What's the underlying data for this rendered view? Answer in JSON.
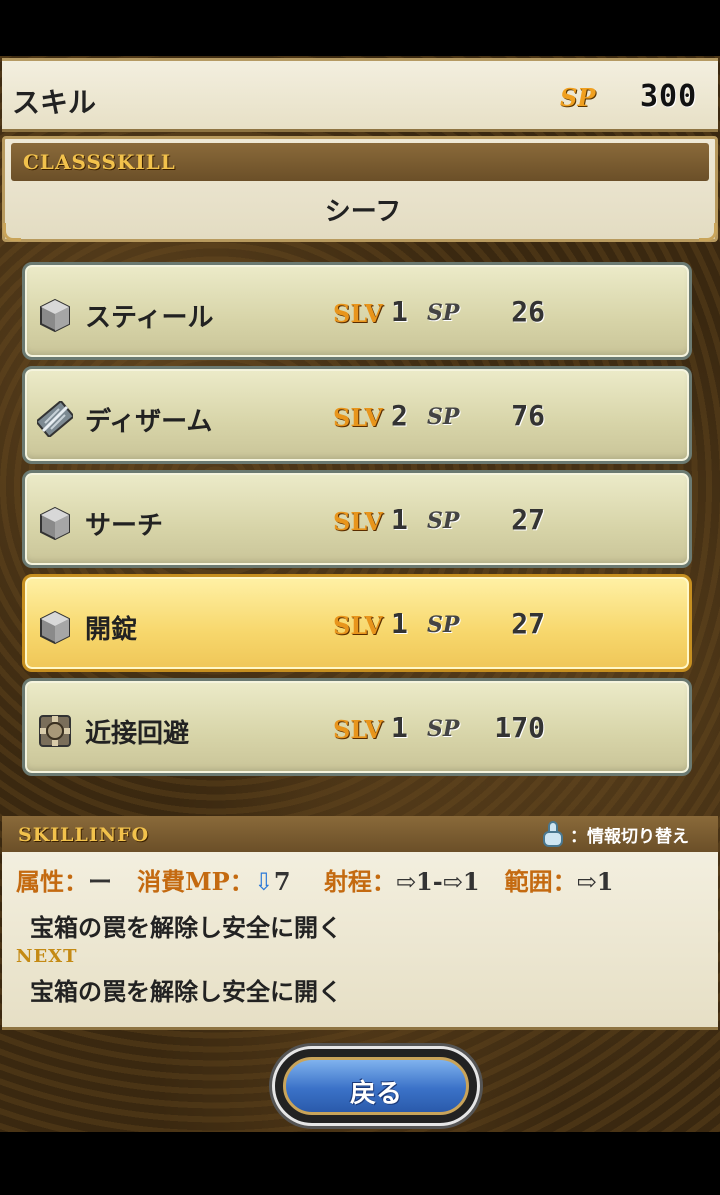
{
  "header": {
    "title": "スキル",
    "sp_label": "SP",
    "sp_value": "300"
  },
  "class_skill": {
    "label": "CLASSSKILL",
    "class_name": "シーフ"
  },
  "skills": [
    {
      "name": "スティール",
      "slv_label": "SLV",
      "slv": "1",
      "sp_label": "SP",
      "sp": "26",
      "icon": "cube-icon",
      "selected": false
    },
    {
      "name": "ディザーム",
      "slv_label": "SLV",
      "slv": "2",
      "sp_label": "SP",
      "sp": "76",
      "icon": "crossed-swords-icon",
      "selected": false
    },
    {
      "name": "サーチ",
      "slv_label": "SLV",
      "slv": "1",
      "sp_label": "SP",
      "sp": "27",
      "icon": "cube-icon",
      "selected": false
    },
    {
      "name": "開錠",
      "slv_label": "SLV",
      "slv": "1",
      "sp_label": "SP",
      "sp": "27",
      "icon": "cube-icon",
      "selected": true
    },
    {
      "name": "近接回避",
      "slv_label": "SLV",
      "slv": "1",
      "sp_label": "SP",
      "sp": "170",
      "icon": "dodge-icon",
      "selected": false
    }
  ],
  "skill_info": {
    "label": "SKILLINFO",
    "toggle_label": "：情報切り替え",
    "attr_label": "属性：",
    "attr_value": "ー",
    "mp_label": "消費MP：",
    "mp_value": "7",
    "range_label": "射程：",
    "range_value": "1-",
    "range_value2": "1",
    "area_label": "範囲：",
    "area_value": "1",
    "description": "宝箱の罠を解除し安全に開く",
    "next_label": "NEXT",
    "next_description": "宝箱の罠を解除し安全に開く"
  },
  "back_button": {
    "label": "戻る"
  }
}
